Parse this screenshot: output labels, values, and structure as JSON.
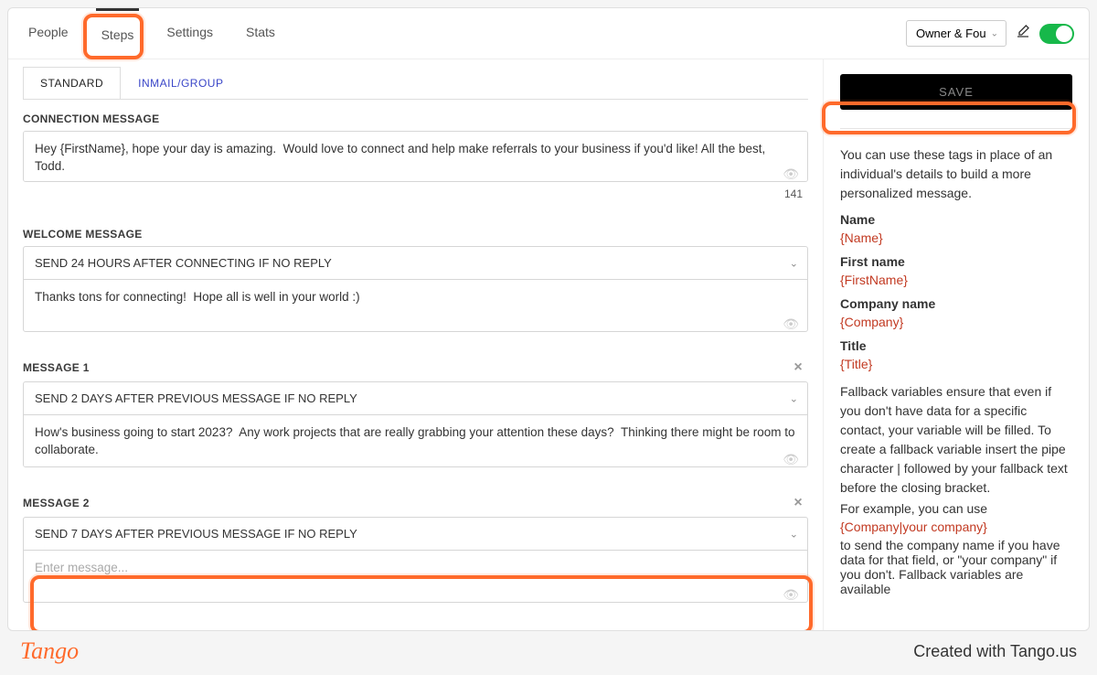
{
  "nav": {
    "tabs": [
      "People",
      "Steps",
      "Settings",
      "Stats"
    ],
    "active_index": 1,
    "owner_select": "Owner & Fou",
    "toggle_on": true
  },
  "subtabs": {
    "items": [
      "STANDARD",
      "INMAIL/GROUP"
    ],
    "active_index": 0
  },
  "sections": {
    "connection": {
      "label": "CONNECTION MESSAGE",
      "text": "Hey {FirstName}, hope your day is amazing.  Would love to connect and help make referrals to your business if you'd like! All the best, Todd.",
      "counter": "141"
    },
    "welcome": {
      "label": "WELCOME MESSAGE",
      "timing": "SEND 24 HOURS AFTER CONNECTING IF NO REPLY",
      "text": "Thanks tons for connecting!  Hope all is well in your world :)"
    },
    "message1": {
      "label": "MESSAGE 1",
      "timing": "SEND 2 DAYS AFTER PREVIOUS MESSAGE IF NO REPLY",
      "text": "How's business going to start 2023?  Any work projects that are really grabbing your attention these days?  Thinking there might be room to collaborate."
    },
    "message2": {
      "label": "MESSAGE 2",
      "timing": "SEND 7 DAYS AFTER PREVIOUS MESSAGE IF NO REPLY",
      "text": "",
      "placeholder": "Enter message..."
    }
  },
  "sidebar": {
    "save_label": "SAVE",
    "intro": "You can use these tags in place of an individual's details to build a more personalized message.",
    "tags": [
      {
        "label": "Name",
        "token": "{Name}"
      },
      {
        "label": "First name",
        "token": "{FirstName}"
      },
      {
        "label": "Company name",
        "token": "{Company}"
      },
      {
        "label": "Title",
        "token": "{Title}"
      }
    ],
    "fallback_p1": "Fallback variables ensure that even if you don't have data for a specific contact, your variable will be filled. To create a fallback variable insert the pipe character | followed by your fallback text before the closing bracket.",
    "fallback_p2a": "For example, you can use",
    "fallback_example": "{Company|your company}",
    "fallback_p2b": "to send the company name if you have data for that field, or \"your company\" if you don't. Fallback variables are available"
  },
  "footer": {
    "logo": "Tango",
    "credit": "Created with Tango.us"
  }
}
